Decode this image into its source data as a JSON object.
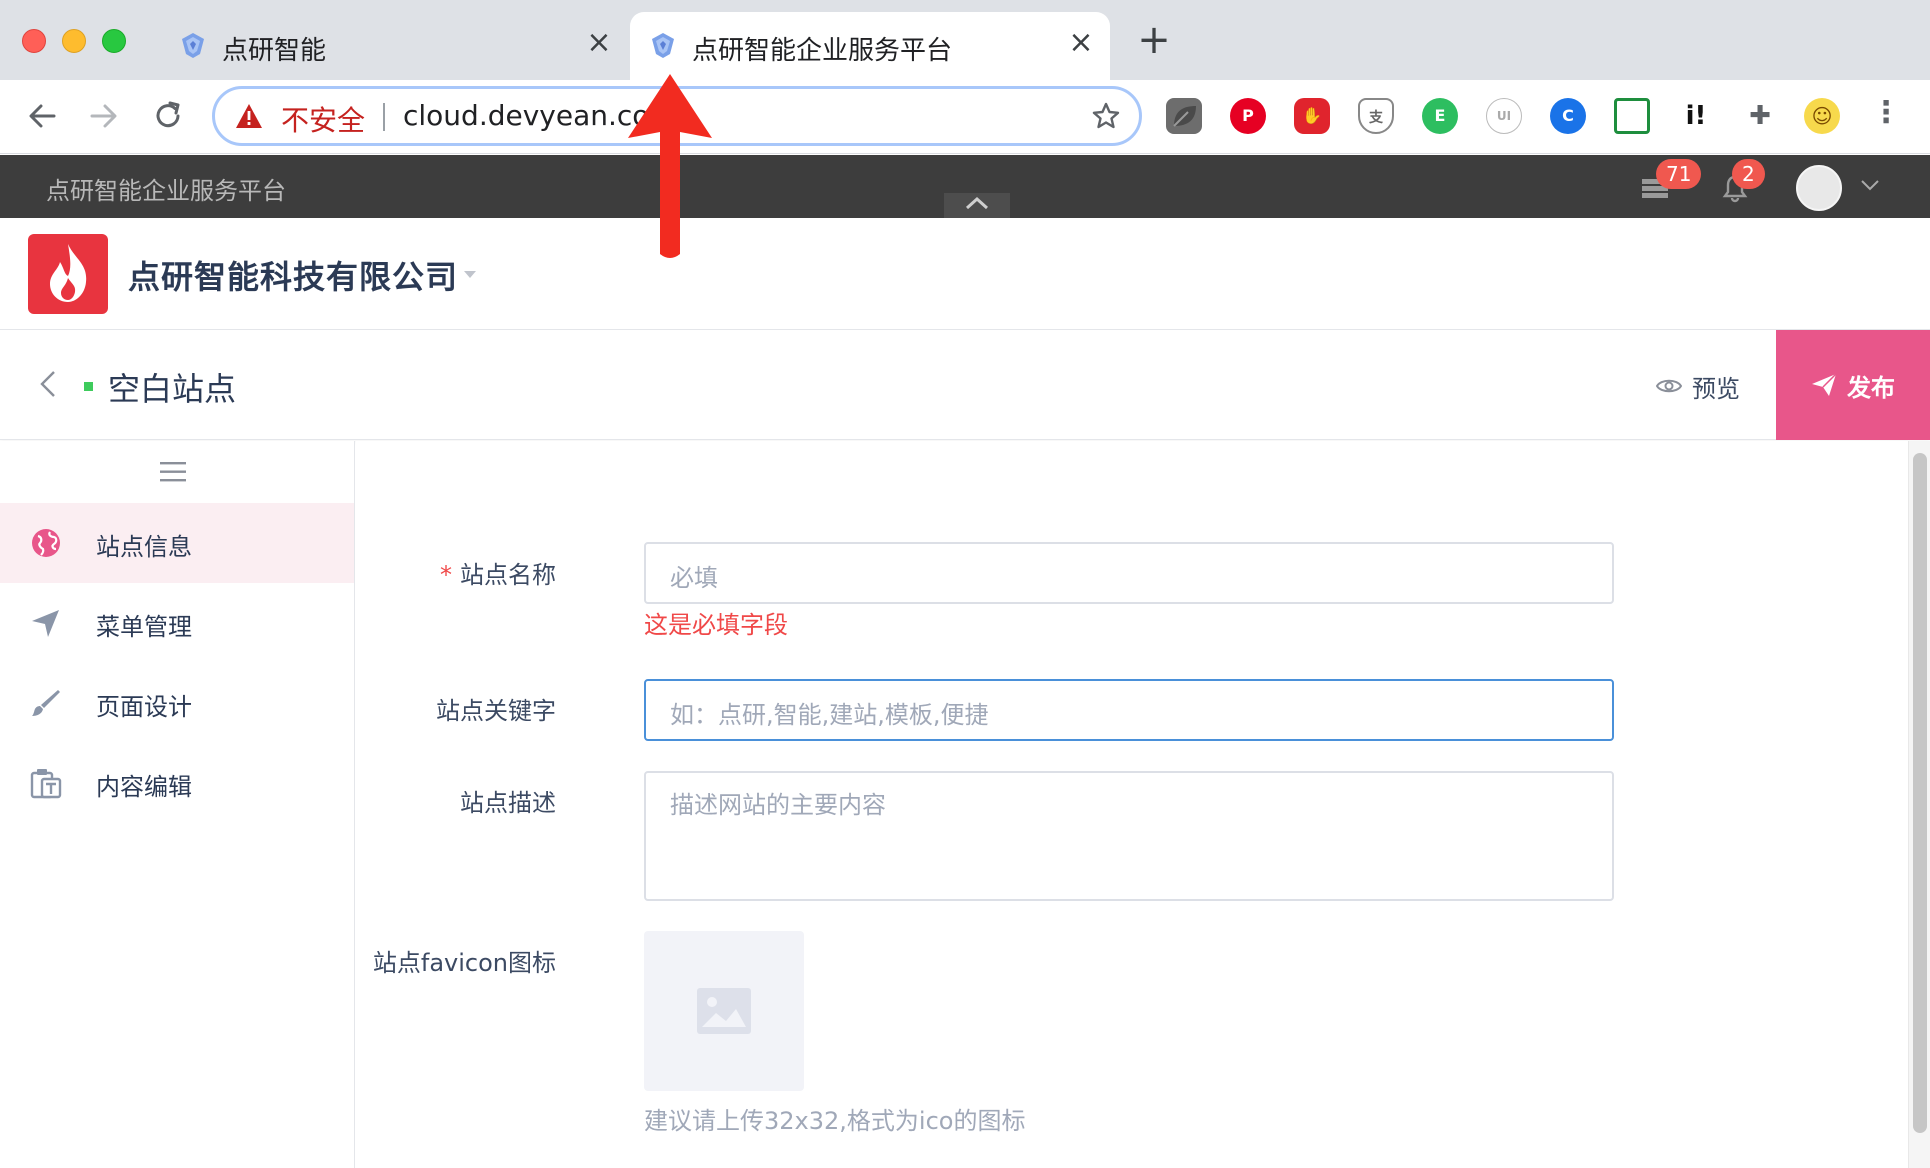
{
  "browser": {
    "tabs": [
      {
        "title": "点研智能",
        "active": false
      },
      {
        "title": "点研智能企业服务平台",
        "active": true
      }
    ],
    "address": {
      "security_label": "不安全",
      "url": "cloud.devyean.com"
    },
    "extensions": [
      "leaf-icon",
      "pinterest-icon",
      "adblock-icon",
      "alipay-shield-icon",
      "evernote-icon",
      "ui-icon",
      "tab-icon",
      "screenshot-icon",
      "info-icon",
      "puzzle-icon",
      "emoji-icon"
    ]
  },
  "appbar": {
    "title": "点研智能企业服务平台",
    "apps_badge": "71",
    "notify_badge": "2"
  },
  "company": {
    "name": "点研智能科技有限公司"
  },
  "page": {
    "title": "空白站点",
    "preview_label": "预览",
    "publish_label": "发布"
  },
  "sidebar": {
    "items": [
      {
        "label": "站点信息",
        "icon": "globe-icon",
        "active": true
      },
      {
        "label": "菜单管理",
        "icon": "navigation-icon",
        "active": false
      },
      {
        "label": "页面设计",
        "icon": "brush-icon",
        "active": false
      },
      {
        "label": "内容编辑",
        "icon": "clipboard-text-icon",
        "active": false
      }
    ]
  },
  "form": {
    "site_name": {
      "required_mark": "*",
      "label": "站点名称",
      "placeholder": "必填",
      "error": "这是必填字段"
    },
    "site_keywords": {
      "label": "站点关键字",
      "placeholder": "如：点研,智能,建站,模板,便捷"
    },
    "site_description": {
      "label": "站点描述",
      "placeholder": "描述网站的主要内容"
    },
    "favicon": {
      "label": "站点favicon图标",
      "hint": "建议请上传32x32,格式为ico的图标"
    }
  },
  "colors": {
    "accent_pink": "#e8568a",
    "error_red": "#f04848",
    "dark_bar": "#3d3d3d",
    "focus_blue": "#4a90d9"
  }
}
